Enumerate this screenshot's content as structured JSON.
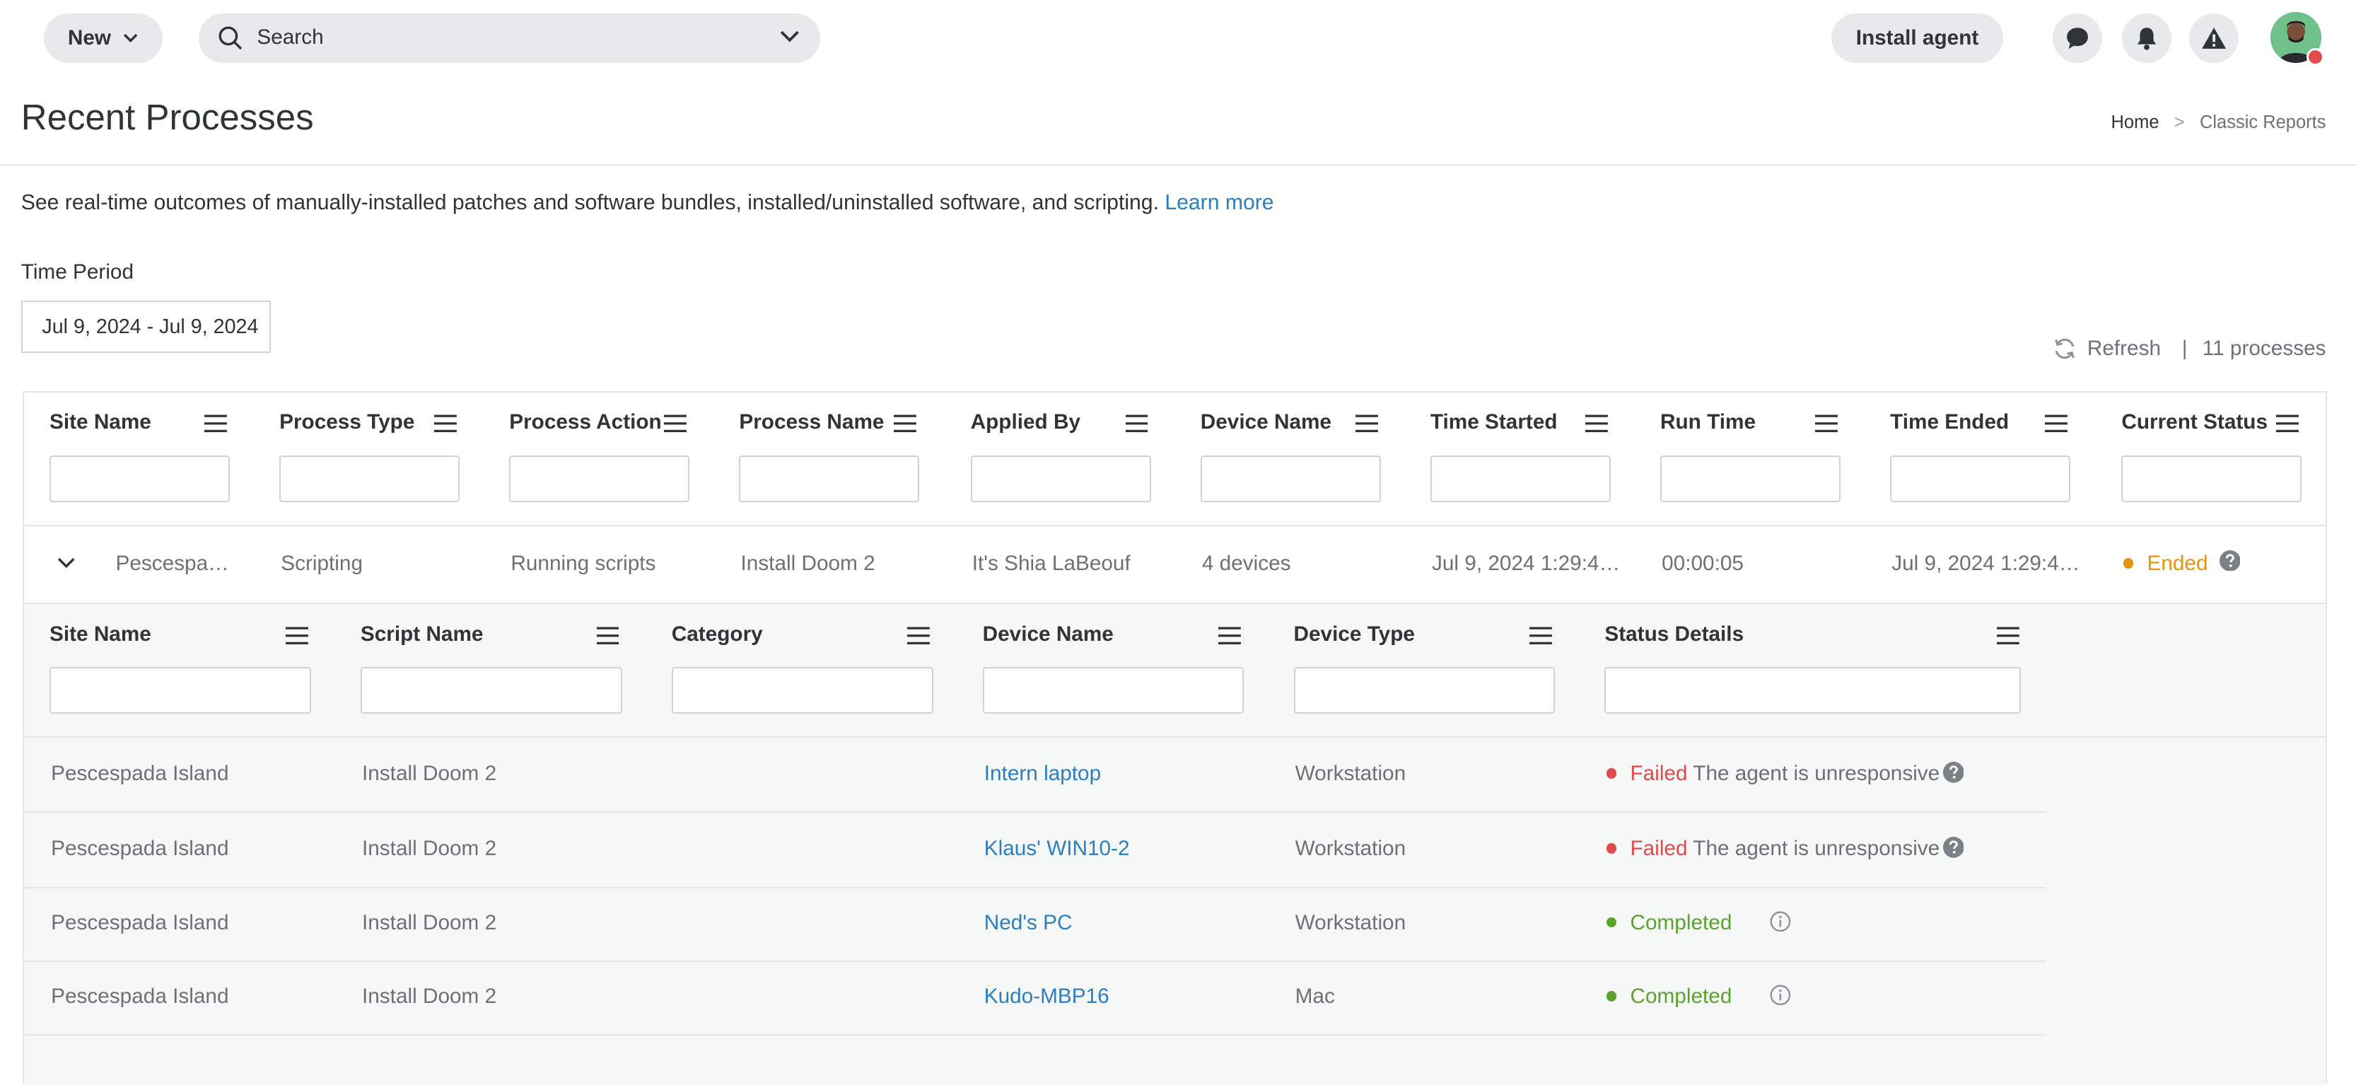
{
  "header": {
    "new_label": "New",
    "search_placeholder": "Search",
    "install_label": "Install agent",
    "icons": [
      "chat-icon",
      "bell-icon",
      "alert-icon",
      "avatar"
    ]
  },
  "page": {
    "title": "Recent Processes",
    "breadcrumb": [
      "Home",
      ">",
      "Classic Reports"
    ],
    "description": "See real-time outcomes of manually-installed patches and software bundles, installed/uninstalled software, and scripting.",
    "learn_more": "Learn more",
    "time_period_label": "Time Period",
    "time_period_value": "Jul 9, 2024 - Jul 9, 2024",
    "refresh_label": "Refresh",
    "pipe": "|",
    "process_count": "11 processes"
  },
  "colors": {
    "link": "#2b7fc1",
    "ended": "#e6930f",
    "failed": "#e24b4b",
    "completed": "#5aa32d"
  },
  "main_table": {
    "columns": [
      "Site Name",
      "Process Type",
      "Process Action",
      "Process Name",
      "Applied By",
      "Device Name",
      "Time Started",
      "Run Time",
      "Time Ended",
      "Current Status"
    ],
    "row": {
      "site": "Pescespa…",
      "type": "Scripting",
      "action": "Running scripts",
      "name": "Install Doom 2",
      "applied_by": "It's Shia LaBeouf",
      "device": "4 devices",
      "started": "Jul 9, 2024 1:29:4…",
      "run_time": "00:00:05",
      "ended": "Jul 9, 2024 1:29:4…",
      "status": "Ended"
    }
  },
  "sub_table": {
    "columns": [
      "Site Name",
      "Script Name",
      "Category",
      "Device Name",
      "Device Type",
      "Status Details"
    ],
    "rows": [
      {
        "site": "Pescespada Island",
        "script": "Install Doom 2",
        "category": "",
        "device": "Intern laptop",
        "type": "Workstation",
        "status": "Failed",
        "detail": "The agent is unresponsive"
      },
      {
        "site": "Pescespada Island",
        "script": "Install Doom 2",
        "category": "",
        "device": "Klaus' WIN10-2",
        "type": "Workstation",
        "status": "Failed",
        "detail": "The agent is unresponsive"
      },
      {
        "site": "Pescespada Island",
        "script": "Install Doom 2",
        "category": "",
        "device": "Ned's PC",
        "type": "Workstation",
        "status": "Completed",
        "detail": ""
      },
      {
        "site": "Pescespada Island",
        "script": "Install Doom 2",
        "category": "",
        "device": "Kudo-MBP16",
        "type": "Mac",
        "status": "Completed",
        "detail": ""
      }
    ]
  }
}
